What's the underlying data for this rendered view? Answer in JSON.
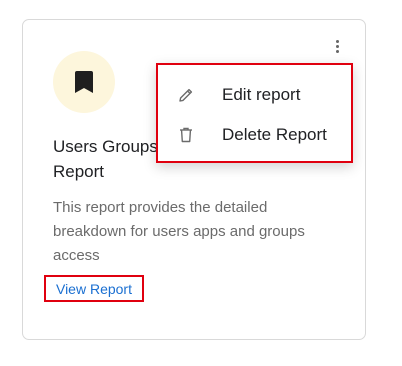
{
  "card": {
    "title": "Users Groups\nReport",
    "description": "This report provides the detailed breakdown for users apps and groups access",
    "view_link": "View Report",
    "icon": "bookmark-icon",
    "icon_bg": "#fdf6dc"
  },
  "menu": {
    "items": [
      {
        "label": "Edit report",
        "icon": "pencil-icon"
      },
      {
        "label": "Delete Report",
        "icon": "trash-icon"
      }
    ]
  },
  "colors": {
    "highlight": "#e0000f",
    "link": "#1a6fd1"
  }
}
